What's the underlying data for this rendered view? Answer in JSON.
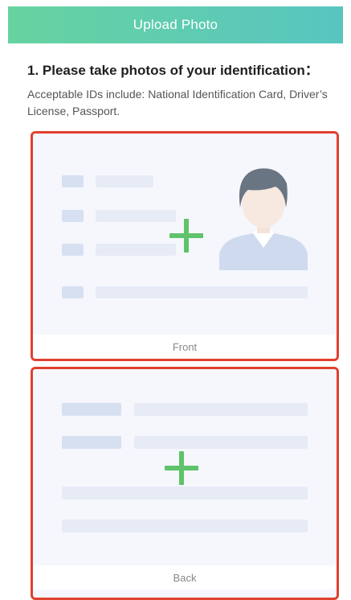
{
  "header": {
    "title": "Upload Photo"
  },
  "instructions": {
    "title": "1. Please take photos of your identification：",
    "description": "Acceptable IDs include: National Identification Card, Driver’s License, Passport."
  },
  "id_cards": [
    {
      "side": "front",
      "label": "Front",
      "icon": "plus-icon"
    },
    {
      "side": "back",
      "label": "Back",
      "icon": "plus-icon"
    }
  ],
  "colors": {
    "header_gradient_start": "#67d3a0",
    "header_gradient_end": "#58c5c1",
    "card_border": "#e0402e",
    "plus_icon": "#5ec36b",
    "placeholder_bar": "#e6ebf6",
    "placeholder_block": "#d6e0f1"
  }
}
